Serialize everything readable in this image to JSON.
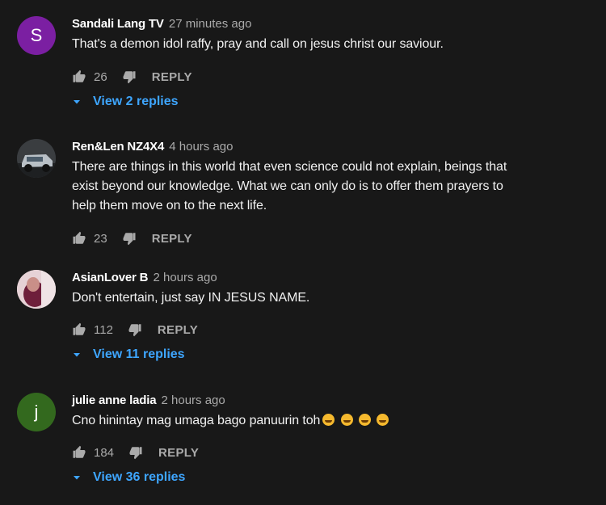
{
  "comments": [
    {
      "author": "Sandali Lang TV",
      "time": "27 minutes ago",
      "avatar_letter": "S",
      "avatar_color": "#7b1fa2",
      "text": [
        "That's a demon idol raffy, pray and call on jesus christ our saviour."
      ],
      "likes": "26",
      "reply_label": "REPLY",
      "view_replies": "View 2 replies"
    },
    {
      "author": "Ren&Len NZ4X4",
      "time": "4 hours ago",
      "avatar_letter": "",
      "avatar_color": "#9aa3ab",
      "text": [
        "There are things in this world that even science could not explain, beings that",
        "exist beyond our knowledge. What we can only do is to offer them prayers to",
        "help them move on to the next life."
      ],
      "likes": "23",
      "reply_label": "REPLY",
      "view_replies": ""
    },
    {
      "author": "AsianLover B",
      "time": "2 hours ago",
      "avatar_letter": "",
      "avatar_color": "#d9bfc6",
      "text": [
        "Don't entertain, just say IN JESUS NAME."
      ],
      "likes": "112",
      "reply_label": "REPLY",
      "view_replies": "View 11 replies"
    },
    {
      "author": "julie anne ladia",
      "time": "2 hours ago",
      "avatar_letter": "j",
      "avatar_color": "#33691e",
      "text": [
        "Cno hinintay mag umaga bago panuurin toh"
      ],
      "emoji_count": 4,
      "likes": "184",
      "reply_label": "REPLY",
      "view_replies": "View 36 replies"
    }
  ],
  "colors": {
    "background": "#181818",
    "link": "#3ea6ff",
    "muted": "#aaaaaa"
  },
  "icons": {
    "like": "thumbs-up-icon",
    "dislike": "thumbs-down-icon",
    "expand": "chevron-down-icon"
  }
}
